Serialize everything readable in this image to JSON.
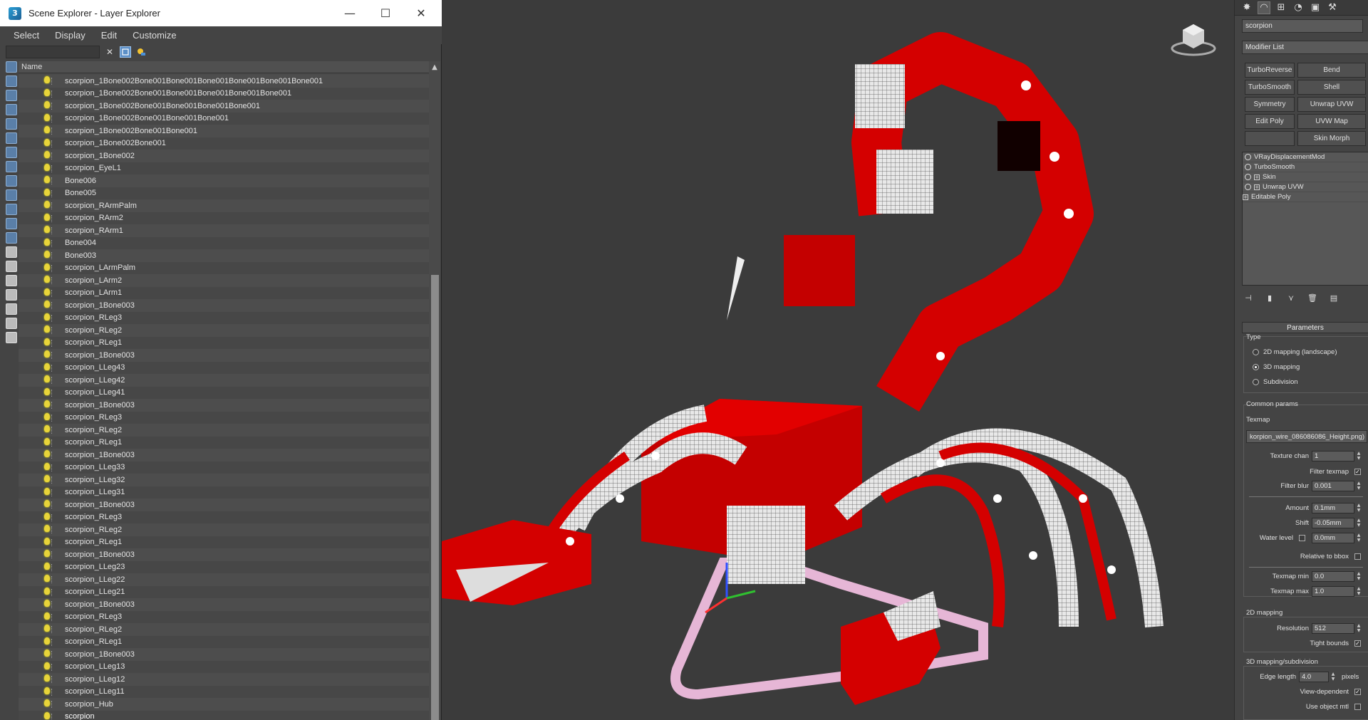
{
  "window": {
    "title": "Scene Explorer - Layer Explorer",
    "app_icon_glyph": "3",
    "minimize": "—",
    "maximize": "☐",
    "close": "✕"
  },
  "menu": [
    "Select",
    "Display",
    "Edit",
    "Customize"
  ],
  "search": {
    "clear_glyph": "✕"
  },
  "list": {
    "column_header": "Name",
    "rows": [
      "scorpion_1Bone002Bone001Bone001Bone001Bone001Bone001Bone001",
      "scorpion_1Bone002Bone001Bone001Bone001Bone001Bone001",
      "scorpion_1Bone002Bone001Bone001Bone001Bone001",
      "scorpion_1Bone002Bone001Bone001Bone001",
      "scorpion_1Bone002Bone001Bone001",
      "scorpion_1Bone002Bone001",
      "scorpion_1Bone002",
      "scorpion_EyeL1",
      "Bone006",
      "Bone005",
      "scorpion_RArmPalm",
      "scorpion_RArm2",
      "scorpion_RArm1",
      "Bone004",
      "Bone003",
      "scorpion_LArmPalm",
      "scorpion_LArm2",
      "scorpion_LArm1",
      "scorpion_1Bone003",
      "scorpion_RLeg3",
      "scorpion_RLeg2",
      "scorpion_RLeg1",
      "scorpion_1Bone003",
      "scorpion_LLeg43",
      "scorpion_LLeg42",
      "scorpion_LLeg41",
      "scorpion_1Bone003",
      "scorpion_RLeg3",
      "scorpion_RLeg2",
      "scorpion_RLeg1",
      "scorpion_1Bone003",
      "scorpion_LLeg33",
      "scorpion_LLeg32",
      "scorpion_LLeg31",
      "scorpion_1Bone003",
      "scorpion_RLeg3",
      "scorpion_RLeg2",
      "scorpion_RLeg1",
      "scorpion_1Bone003",
      "scorpion_LLeg23",
      "scorpion_LLeg22",
      "scorpion_LLeg21",
      "scorpion_1Bone003",
      "scorpion_RLeg3",
      "scorpion_RLeg2",
      "scorpion_RLeg1",
      "scorpion_1Bone003",
      "scorpion_LLeg13",
      "scorpion_LLeg12",
      "scorpion_LLeg11",
      "scorpion_Hub",
      "scorpion"
    ],
    "scroll_up": "▲"
  },
  "command_panel": {
    "object_name": "scorpion",
    "modifier_list": "Modifier List",
    "modifier_buttons": [
      "TurboReverse",
      "Bend",
      "TurboSmooth",
      "Shell",
      "Symmetry",
      "Unwrap UVW",
      "Edit Poly",
      "UVW Map",
      "",
      "Skin Morph"
    ],
    "stack": [
      "VRayDisplacementMod",
      "TurboSmooth",
      "Skin",
      "Unwrap UVW",
      "Editable Poly"
    ],
    "parameters": {
      "rollout_title": "Parameters",
      "type_label": "Type",
      "type_options": [
        "2D mapping (landscape)",
        "3D mapping",
        "Subdivision"
      ],
      "type_selected": 1,
      "common_params": "Common params",
      "texmap_label": "Texmap",
      "texmap_value": "korpion_wire_086086086_Height.png)",
      "texture_chan_label": "Texture chan",
      "texture_chan_value": "1",
      "filter_texmap_label": "Filter texmap",
      "filter_texmap_checked": "✓",
      "filter_blur_label": "Filter blur",
      "filter_blur_value": "0.001",
      "amount_label": "Amount",
      "amount_value": "0.1mm",
      "shift_label": "Shift",
      "shift_value": "-0.05mm",
      "water_level_label": "Water level",
      "water_level_value": "0.0mm",
      "relative_bbox_label": "Relative to bbox",
      "texmap_min_label": "Texmap min",
      "texmap_min_value": "0.0",
      "texmap_max_label": "Texmap max",
      "texmap_max_value": "1.0",
      "mapping2d_label": "2D mapping",
      "resolution_label": "Resolution",
      "resolution_value": "512",
      "tight_bounds_label": "Tight bounds",
      "tight_bounds_checked": "✓",
      "mapping3d_label": "3D mapping/subdivision",
      "edge_length_label": "Edge length",
      "edge_length_value": "4.0",
      "pixels_label": "pixels",
      "view_dependent_label": "View-dependent",
      "view_dependent_checked": "✓",
      "use_object_mtl_label": "Use object mtl"
    }
  },
  "colors": {
    "scorpion_red": "#d40000",
    "bulb_yellow": "#e8d43a",
    "selection_blue": "#5b8fc7"
  }
}
